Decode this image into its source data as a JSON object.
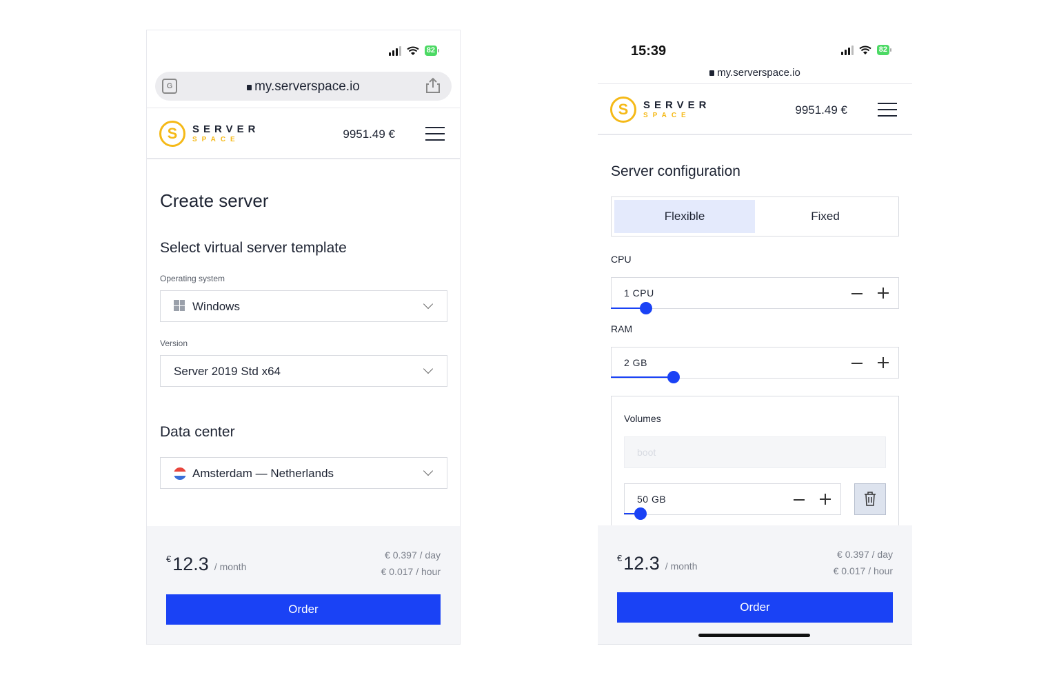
{
  "left": {
    "status": {
      "battery": "82"
    },
    "url": "my.serverspace.io",
    "header": {
      "logo_top": "SERVER",
      "logo_bottom": "SPACE",
      "balance": "9951.49 €"
    },
    "page_title": "Create server",
    "template_heading": "Select virtual server template",
    "os_label": "Operating system",
    "os_value": "Windows",
    "version_label": "Version",
    "version_value": "Server 2019 Std x64",
    "datacenter_heading": "Data center",
    "datacenter_value": "Amsterdam — Netherlands",
    "footer": {
      "currency": "€",
      "price": "12.3",
      "per": "/ month",
      "per_day": "€ 0.397 / day",
      "per_hour": "€ 0.017 / hour",
      "order_label": "Order"
    }
  },
  "right": {
    "status": {
      "time": "15:39",
      "battery": "82"
    },
    "url": "my.serverspace.io",
    "header": {
      "logo_top": "SERVER",
      "logo_bottom": "SPACE",
      "balance": "9951.49 €"
    },
    "config_heading": "Server configuration",
    "tabs": {
      "flexible": "Flexible",
      "fixed": "Fixed"
    },
    "cpu_label": "CPU",
    "cpu_value": "1 CPU",
    "ram_label": "RAM",
    "ram_value": "2 GB",
    "volumes_label": "Volumes",
    "boot_placeholder": "boot",
    "volume_size": "50 GB",
    "footer": {
      "currency": "€",
      "price": "12.3",
      "per": "/ month",
      "per_day": "€ 0.397 / day",
      "per_hour": "€ 0.017 / hour",
      "order_label": "Order"
    }
  },
  "colors": {
    "accent": "#1a42f5",
    "brand_yellow": "#f5b917",
    "tab_active_bg": "#e4eafc"
  }
}
